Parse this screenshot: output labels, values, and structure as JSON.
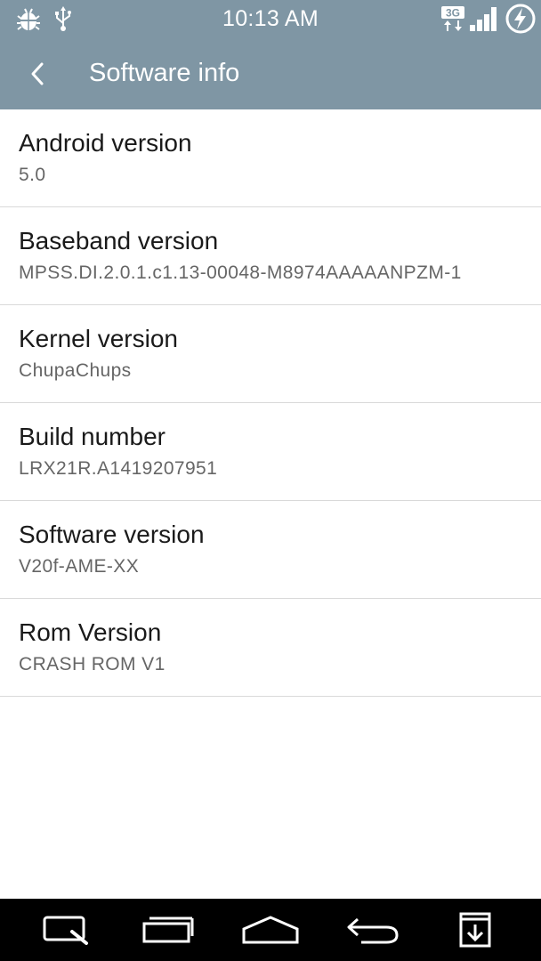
{
  "colors": {
    "header_bg": "#7f96a4",
    "list_divider": "#d9d9d9",
    "nav_bg": "#000000"
  },
  "status_bar": {
    "time": "10:13 AM",
    "network_label": "3G",
    "icons": [
      "android-debug-icon",
      "usb-icon",
      "3g-data-icon",
      "signal-strength-icon",
      "battery-charging-icon"
    ]
  },
  "action_bar": {
    "back_icon": "chevron-left-icon",
    "title": "Software info"
  },
  "items": [
    {
      "title": "Android version",
      "value": "5.0"
    },
    {
      "title": "Baseband version",
      "value": "MPSS.DI.2.0.1.c1.13-00048-M8974AAAAANPZM-1"
    },
    {
      "title": "Kernel version",
      "value": "ChupaChups"
    },
    {
      "title": "Build number",
      "value": "LRX21R.A1419207951"
    },
    {
      "title": "Software version",
      "value": "V20f-AME-XX"
    },
    {
      "title": "Rom Version",
      "value": "CRASH ROM V1"
    }
  ],
  "nav_bar": {
    "buttons": [
      "qslide-icon",
      "recents-icon",
      "home-icon",
      "back-icon",
      "notification-pull-icon"
    ]
  }
}
